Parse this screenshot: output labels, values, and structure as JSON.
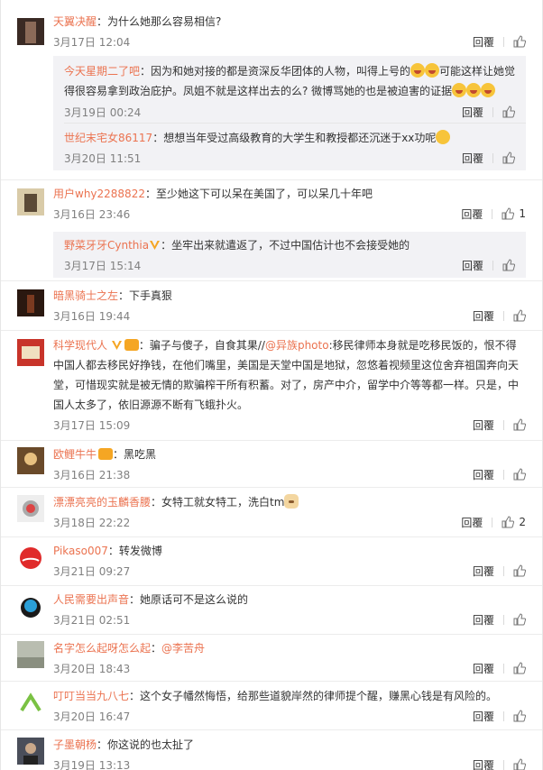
{
  "ui": {
    "reply_label": "回覆"
  },
  "c1": {
    "name": "天翼决醒",
    "text": "为什么她那么容易相信?",
    "time": "3月17日 12:04"
  },
  "c1s1": {
    "name": "今天星期二了吧",
    "text_a": "因为和她对接的都是资深反华团体的人物，叫得上号的",
    "text_b": "可能这样让她觉得很容易拿到政治庇护。凤姐不就是这样出去的么? 微博骂她的也是被迫害的证据",
    "time": "3月19日 00:24"
  },
  "c1s2": {
    "name": "世纪末宅女86117",
    "text": "想想当年受过高级教育的大学生和教授都还沉迷于xx功呢",
    "time": "3月20日 11:51"
  },
  "c2": {
    "name": "用户why2288822",
    "text": "至少她这下可以呆在美国了，可以呆几十年吧",
    "time": "3月16日 23:46",
    "likes": "1"
  },
  "c2s1": {
    "name": "野菜牙牙Cynthia",
    "text": "坐牢出来就遣返了，不过中国估计也不会接受她的",
    "time": "3月17日 15:14"
  },
  "c3": {
    "name": "暗黑骑士之左",
    "text": "下手真狠",
    "time": "3月16日 19:44"
  },
  "c4": {
    "name": "科学现代人",
    "text_a": "骗子与傻子，自食其果//",
    "mention": "@异族photo",
    "text_b": ":移民律师本身就是吃移民饭的，恨不得中国人都去移民好挣钱，在他们嘴里，美国是天堂中国是地狱，忽悠着视频里这位舍弃祖国奔向天堂，可惜现实就是被无情的欺骗榨干所有积蓄。对了，房产中介，留学中介等等都一样。只是，中国人太多了，依旧源源不断有飞蛾扑火。",
    "time": "3月17日 15:09"
  },
  "c5": {
    "name": "欧鲤牛牛",
    "text": "黑吃黑",
    "time": "3月16日 21:38"
  },
  "c6": {
    "name": "漂漂亮亮的玉麟香腰",
    "text": "女特工就女特工，洗白tm",
    "time": "3月18日 22:22",
    "likes": "2"
  },
  "c7": {
    "name": "Pikaso007",
    "text": "转发微博",
    "time": "3月21日 09:27"
  },
  "c8": {
    "name": "人民需要出声音",
    "text": "她原话可不是这么说的",
    "time": "3月21日 02:51"
  },
  "c9": {
    "name": "名字怎么起呀怎么起",
    "mention": "@李苦舟",
    "time": "3月20日 18:43"
  },
  "c10": {
    "name": "叮叮当当九八七",
    "text": "这个女子幡然悔悟，给那些道貌岸然的律师提个醒，赚黑心钱是有风险的。",
    "time": "3月20日 16:47"
  },
  "c11": {
    "name": "子墨朝杨",
    "text": "你这说的也太扯了",
    "time": "3月19日 13:13"
  }
}
